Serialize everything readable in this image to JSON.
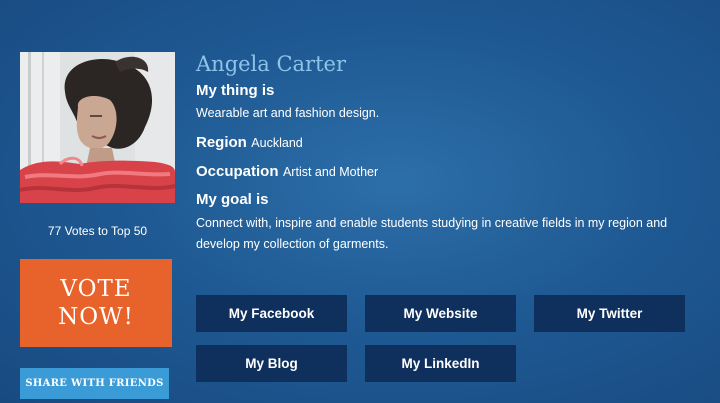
{
  "profile": {
    "name": "Angela Carter",
    "thing_label": "My thing is",
    "thing_value": "Wearable art and fashion design.",
    "region_label": "Region",
    "region_value": "Auckland",
    "occupation_label": "Occupation",
    "occupation_value": "Artist and Mother",
    "goal_label": "My goal is",
    "goal_value": "Connect with, inspire and enable students studying in creative fields in my region and develop my collection of garments."
  },
  "sidebar": {
    "votes_text": "77 Votes to Top 50",
    "vote_button": "VOTE NOW!",
    "share_button": "SHARE WITH FRIENDS"
  },
  "links": [
    {
      "label": "My Facebook"
    },
    {
      "label": "My Website"
    },
    {
      "label": "My Twitter"
    },
    {
      "label": "My Blog"
    },
    {
      "label": "My LinkedIn"
    }
  ],
  "colors": {
    "background": "#1f5a94",
    "name_text": "#8fc3ea",
    "vote_button": "#e8632b",
    "share_button": "#3a9bd7",
    "link_button": "#0f2f5c"
  }
}
